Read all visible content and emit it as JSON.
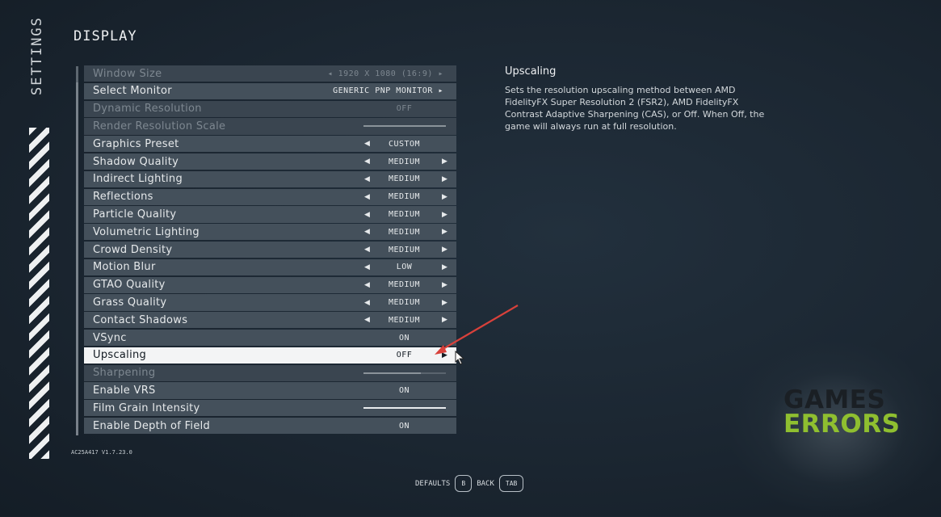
{
  "sidebar": {
    "title": "SETTINGS"
  },
  "page": {
    "title": "DISPLAY"
  },
  "settings": [
    {
      "label": "Window Size",
      "value": "◂ 1920 X 1080 (16:9) ▸",
      "state": "disabled",
      "type": "value-right"
    },
    {
      "label": "Select Monitor",
      "value": "GENERIC PNP MONITOR ▸",
      "state": "normal",
      "type": "value-right"
    },
    {
      "label": "Dynamic Resolution",
      "value": "OFF",
      "state": "disabled",
      "type": "value"
    },
    {
      "label": "Render Resolution Scale",
      "value": "",
      "state": "disabled",
      "type": "slider",
      "level": 1.0
    },
    {
      "label": "Graphics Preset",
      "value": "CUSTOM",
      "state": "normal",
      "type": "left-arrow"
    },
    {
      "label": "Shadow Quality",
      "value": "MEDIUM",
      "state": "normal",
      "type": "arrows"
    },
    {
      "label": "Indirect Lighting",
      "value": "MEDIUM",
      "state": "normal",
      "type": "arrows"
    },
    {
      "label": "Reflections",
      "value": "MEDIUM",
      "state": "normal",
      "type": "arrows"
    },
    {
      "label": "Particle Quality",
      "value": "MEDIUM",
      "state": "normal",
      "type": "arrows"
    },
    {
      "label": "Volumetric Lighting",
      "value": "MEDIUM",
      "state": "normal",
      "type": "arrows"
    },
    {
      "label": "Crowd Density",
      "value": "MEDIUM",
      "state": "normal",
      "type": "arrows"
    },
    {
      "label": "Motion Blur",
      "value": "LOW",
      "state": "normal",
      "type": "arrows"
    },
    {
      "label": "GTAO Quality",
      "value": "MEDIUM",
      "state": "normal",
      "type": "arrows"
    },
    {
      "label": "Grass Quality",
      "value": "MEDIUM",
      "state": "normal",
      "type": "arrows"
    },
    {
      "label": "Contact Shadows",
      "value": "MEDIUM",
      "state": "normal",
      "type": "arrows"
    },
    {
      "label": "VSync",
      "value": "ON",
      "state": "normal",
      "type": "value"
    },
    {
      "label": "Upscaling",
      "value": "OFF",
      "state": "selected",
      "type": "right-arrow"
    },
    {
      "label": "Sharpening",
      "value": "",
      "state": "disabled",
      "type": "slider",
      "level": 0.7
    },
    {
      "label": "Enable VRS",
      "value": "ON",
      "state": "normal",
      "type": "value"
    },
    {
      "label": "Film Grain Intensity",
      "value": "",
      "state": "normal",
      "type": "slider",
      "level": 1.0
    },
    {
      "label": "Enable Depth of Field",
      "value": "ON",
      "state": "normal",
      "type": "value"
    }
  ],
  "description": {
    "title": "Upscaling",
    "text": "Sets the resolution upscaling method between AMD FidelityFX Super Resolution 2 (FSR2), AMD FidelityFX Contrast Adaptive Sharpening (CAS), or Off.  When Off, the game will always run at full resolution."
  },
  "version": "AC25A417 V1.7.23.0",
  "footer": {
    "defaults_label": "DEFAULTS",
    "defaults_key": "B",
    "back_label": "BACK",
    "back_key": "TAB"
  },
  "watermark": {
    "line1": "GAMES",
    "line2": "ERRORS",
    "color1": "#1a1f24",
    "color2": "#8fbf30"
  },
  "colors": {
    "row": "#44505b",
    "selected": "#f3f4f5",
    "annotation_arrow": "#d8413b"
  }
}
